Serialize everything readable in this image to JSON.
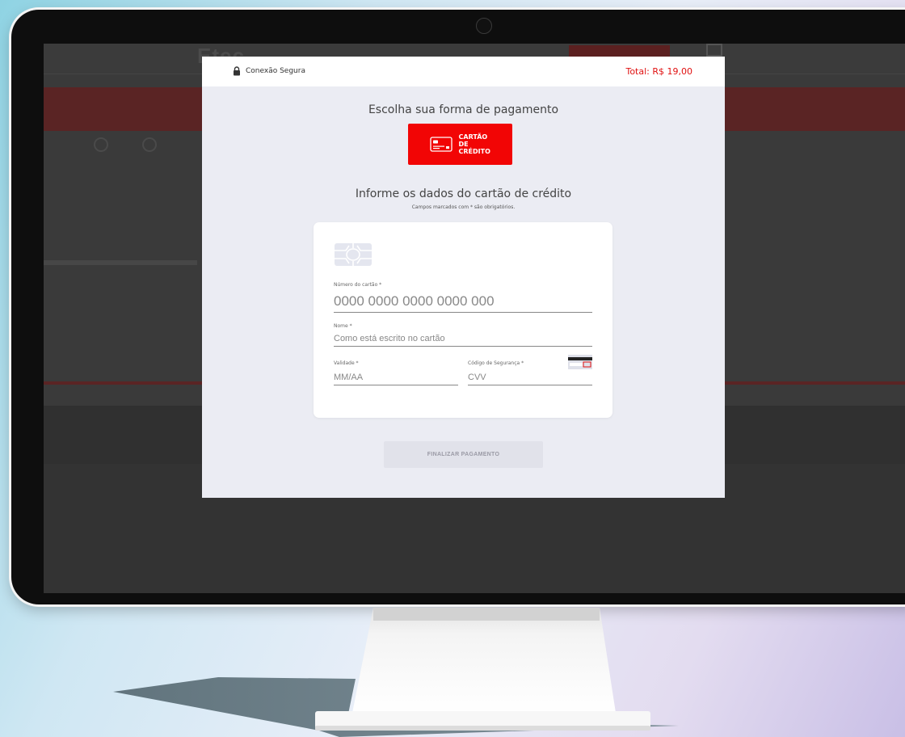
{
  "background_site": {
    "logo": "Etec"
  },
  "modal": {
    "secure_label": "Conexão Segura",
    "total_label": "Total: R$ 19,00",
    "choose_title": "Escolha sua forma de pagamento",
    "payment_option": "CARTÃO DE CRÉDITO",
    "form_title": "Informe os dados do cartão de crédito",
    "required_note": "Campos marcados com * são obrigatórios.",
    "fields": {
      "card_number": {
        "label": "Número do cartão *",
        "placeholder": "0000 0000 0000 0000 000"
      },
      "name": {
        "label": "Nome *",
        "placeholder": "Como está escrito no cartão"
      },
      "validity": {
        "label": "Validade *",
        "placeholder": "MM/AA"
      },
      "cvv": {
        "label": "Código de Segurança *",
        "placeholder": "CVV"
      }
    },
    "finish_button": "FINALIZAR PAGAMENTO"
  },
  "colors": {
    "accent_red": "#f20505",
    "total_red": "#e01010",
    "modal_bg": "#ebecf3",
    "overlay": "#3a3a3a"
  },
  "icons": [
    "lock-icon",
    "credit-card-icon",
    "card-chip-icon",
    "cvv-card-icon"
  ]
}
